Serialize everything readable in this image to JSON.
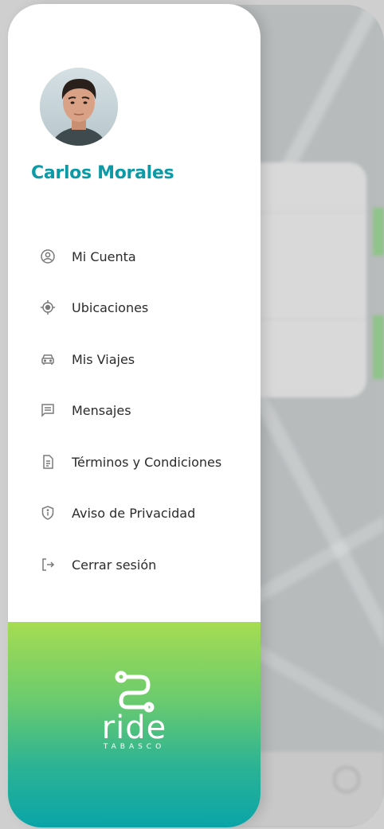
{
  "user": {
    "name": "Carlos Morales"
  },
  "menu": {
    "items": [
      {
        "label": "Mi Cuenta",
        "icon": "user-circle-icon"
      },
      {
        "label": "Ubicaciones",
        "icon": "location-target-icon"
      },
      {
        "label": "Mis Viajes",
        "icon": "car-icon"
      },
      {
        "label": "Mensajes",
        "icon": "message-icon"
      },
      {
        "label": "Términos y Condiciones",
        "icon": "document-icon"
      },
      {
        "label": "Aviso de Privacidad",
        "icon": "info-shield-icon"
      },
      {
        "label": "Cerrar sesión",
        "icon": "logout-icon"
      }
    ]
  },
  "brand": {
    "word": "ride",
    "sub": "TABASCO"
  },
  "colors": {
    "accent": "#0b9aa6",
    "gradient_top": "#a6dc52",
    "gradient_bottom": "#0aa4a8",
    "icon": "#7a7a7a"
  }
}
